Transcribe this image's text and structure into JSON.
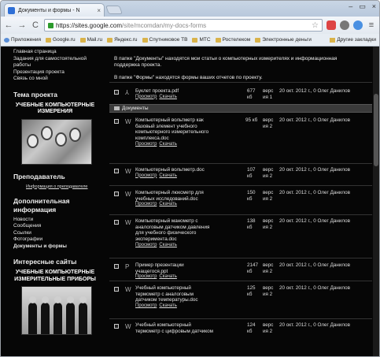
{
  "browser": {
    "tab_title": "Документы и формы - N",
    "tab_close": "×",
    "window_controls": [
      "–",
      "▭",
      "×"
    ],
    "url_host": "https://sites.google.com",
    "url_path": "/site/mcomdan/my-docs-forms",
    "back": "←",
    "forward": "→",
    "reload": "C"
  },
  "bookmarks": [
    {
      "label": "Приложения",
      "kind": "apps"
    },
    {
      "label": "Google.ru",
      "kind": "folder"
    },
    {
      "label": "Mail.ru",
      "kind": "folder"
    },
    {
      "label": "Яндекс.ru",
      "kind": "folder"
    },
    {
      "label": "Спутниковое ТВ",
      "kind": "folder"
    },
    {
      "label": "МТС",
      "kind": "folder"
    },
    {
      "label": "Ростелеком",
      "kind": "folder"
    },
    {
      "label": "Электронные деньги",
      "kind": "folder"
    }
  ],
  "bookmarks_other": "Другие закладки",
  "sidebar": {
    "top_links": [
      "Главная страница",
      "Задания для самостоятельной работы",
      "Презентация проекта",
      "Связь со мной"
    ],
    "theme_heading": "Тема проекта",
    "theme_title": "УЧЕБНЫЕ КОМПЬЮТЕРНЫЕ ИЗМЕРЕНИЯ",
    "teacher_heading": "Преподаватель",
    "teacher_link": "Информация о преподавателе",
    "extra_heading": "Дополнительная информация",
    "extra_links": [
      "Новости",
      "Сообщения",
      "Ссылки",
      "Фотографии",
      "Документы и формы"
    ],
    "sites_heading": "Интересные сайты",
    "sites_title": "УЧЕБНЫЕ КОМПЬЮТЕРНЫЕ ИЗМЕРИТЕЛЬНЫЕ ПРИБОРЫ"
  },
  "main": {
    "intro1": "В папке \"Документы\" находятся мои статьи о компьютерных измерителях и информационная поддержка проекта.",
    "intro2": "В папке \"Формы\" находятся формы ваших отчетов по проекту.",
    "folder_name": "Документы",
    "view_label": "Просмотр",
    "download_label": "Скачать",
    "files": [
      {
        "name": "Буклет проекта.pdf",
        "icon": "pdf-icon",
        "size": "677 кб",
        "ver": "верс ия 1",
        "date": "20 окт. 2012 г., 0 Олег Данилов"
      },
      {
        "name": "Компьютерный вольтметр как базовый элемент учебного компьютерного измерительного комплекса.doc",
        "icon": "word-icon",
        "size": "95 кб",
        "ver": "верс ия 2",
        "date": "20 окт. 2012 г., 0 Олег Данилов"
      },
      {
        "name": "Компьютерный вольтметр.doc",
        "icon": "word-icon",
        "size": "107 кб",
        "ver": "верс ия 2",
        "date": "20 окт. 2012 г., 0 Олег Данилов"
      },
      {
        "name": "Компьютерный люксметр для учебных исследований.doc",
        "icon": "word-icon",
        "size": "150 кб",
        "ver": "верс ия 2",
        "date": "20 окт. 2012 г., 0 Олег Данилов"
      },
      {
        "name": "Компьютерный манометр с аналоговым датчиком давления для учебного физического эксперимента.doc",
        "icon": "word-icon",
        "size": "138 кб",
        "ver": "верс ия 2",
        "date": "20 окт. 2012 г., 0 Олег Данилов"
      },
      {
        "name": "Пример презентации учащегося.ppt",
        "icon": "ppt-icon",
        "size": "2147 кб",
        "ver": "верс ия 2",
        "date": "20 окт. 2012 г., 0 Олег Данилов"
      },
      {
        "name": "Учебный компьютерный термометр с аналоговым датчиком температуры.doc",
        "icon": "word-icon",
        "size": "125 кб",
        "ver": "верс ия 2",
        "date": "20 окт. 2012 г., 0 Олег Данилов"
      },
      {
        "name": "Учебный компьютерный термометр с цифровым датчиком",
        "icon": "word-icon",
        "size": "124 кб",
        "ver": "верс ия 2",
        "date": "20 окт. 2012 г., 0 Олег Данилов"
      }
    ]
  }
}
